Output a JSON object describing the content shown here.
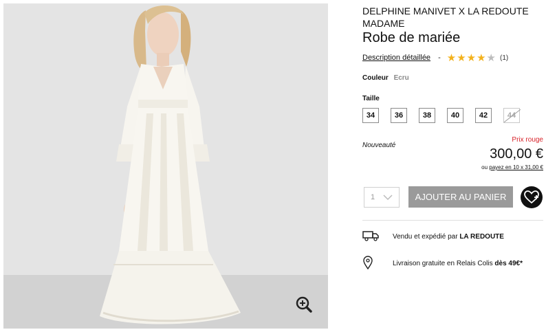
{
  "product": {
    "brand": "DELPHINE MANIVET X LA REDOUTE MADAME",
    "title": "Robe de mariée",
    "description_link": "Description détaillée",
    "separator": "-",
    "rating": {
      "value": 4,
      "max": 5,
      "count": "(1)"
    },
    "color_label": "Couleur",
    "color_value": "Ecru",
    "size_label": "Taille",
    "sizes": [
      {
        "label": "34",
        "available": true
      },
      {
        "label": "36",
        "available": true
      },
      {
        "label": "38",
        "available": true
      },
      {
        "label": "40",
        "available": true
      },
      {
        "label": "42",
        "available": true
      },
      {
        "label": "44",
        "available": false
      }
    ],
    "badge": "Nouveauté",
    "promo_label": "Prix rouge",
    "price": "300,00 €",
    "installment": {
      "prefix": "ou",
      "link": "payez en 10 x 31,00 €"
    },
    "quantity": "1",
    "add_to_cart": "AJOUTER AU PANIER",
    "shipping": {
      "text": "Vendu et expédié par",
      "seller": "LA REDOUTE"
    },
    "delivery": {
      "text": "Livraison gratuite en Relais Colis",
      "threshold": "dès 49€*"
    }
  },
  "icons": {
    "zoom": "zoom-in-icon",
    "wishlist": "heart-plus-icon",
    "truck": "truck-icon",
    "location": "location-pin-icon",
    "chevron": "chevron-down-icon"
  },
  "colors": {
    "accent_red": "#d8232a",
    "star": "#f3b21d",
    "button": "#9a9a9a"
  }
}
